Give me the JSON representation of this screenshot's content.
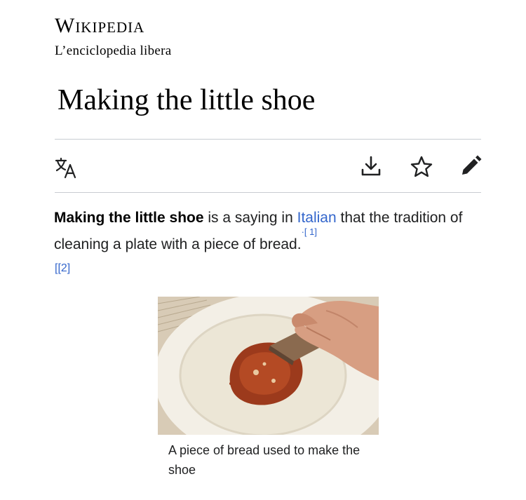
{
  "header": {
    "logo_text": "Wikipedia",
    "tagline": "L’enciclopedia libera"
  },
  "article": {
    "title": "Making the little shoe",
    "lead": {
      "bold_term": "Making the little shoe",
      "text_before_link": " is a saying in ",
      "link_text": "Italian",
      "text_after_link": " that the tradition of cleaning a plate with a piece of bread.",
      "ref1": "·[ 1]",
      "ref2": "[[2]"
    },
    "figure": {
      "caption": "A piece of bread used to make the shoe"
    }
  },
  "toolbar": {
    "icons": [
      "translate-icon",
      "download-icon",
      "star-icon",
      "edit-icon"
    ]
  },
  "colors": {
    "link": "#3366cc",
    "divider": "#c8ccd1",
    "text": "#202122"
  }
}
